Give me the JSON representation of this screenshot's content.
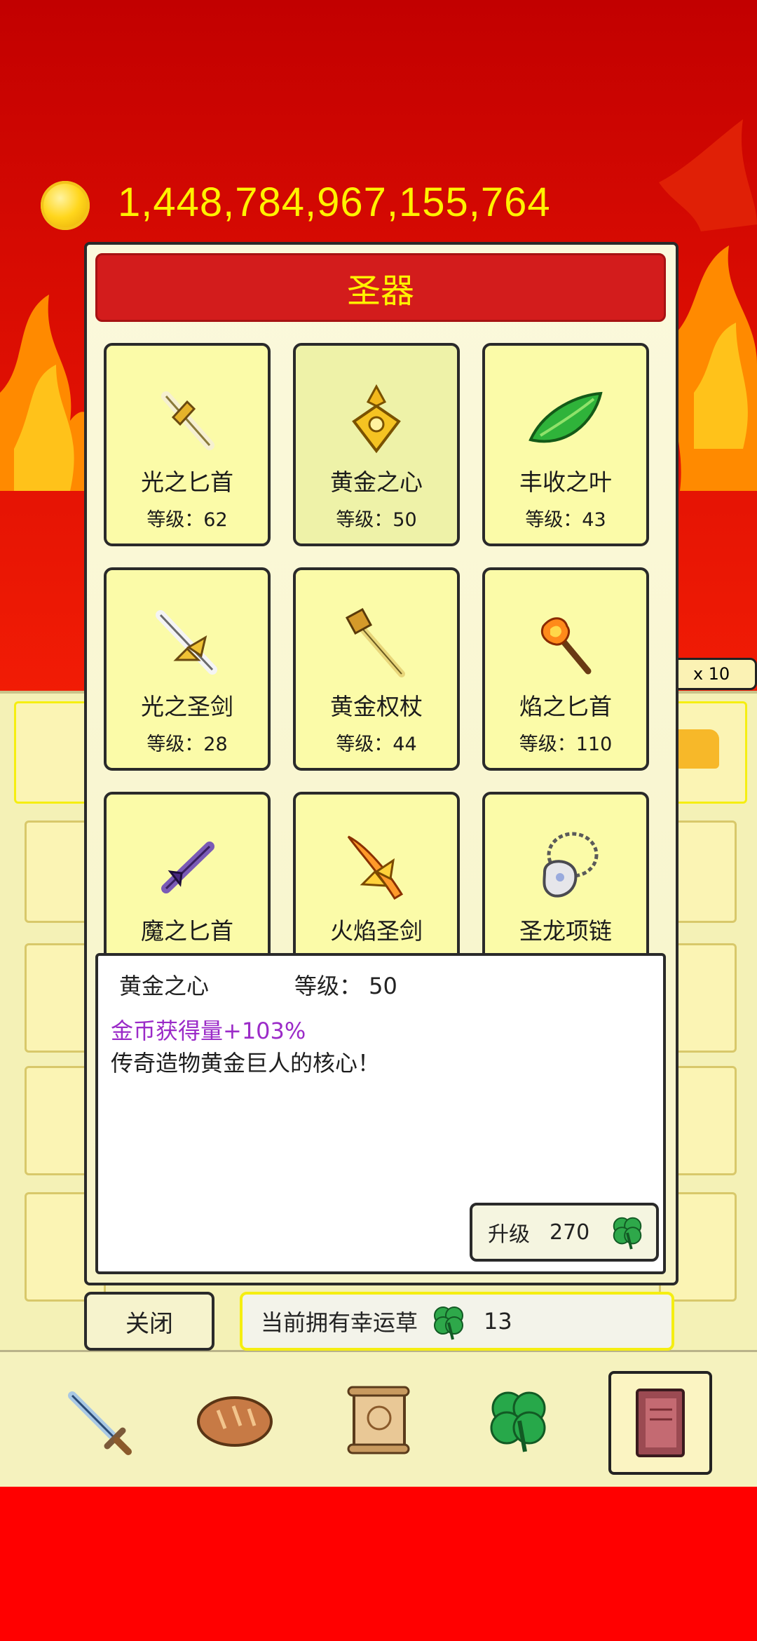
{
  "currency": {
    "amount": "1,448,784,967,155,764",
    "icon": "gold-coin-icon"
  },
  "background": {
    "multiplier_badge": "x 10"
  },
  "dialog": {
    "title": "圣器",
    "artifacts": [
      {
        "name": "光之匕首",
        "level": "等级：62",
        "icon": "light-dagger-icon"
      },
      {
        "name": "黄金之心",
        "level": "等级：50",
        "icon": "golden-heart-icon",
        "selected": true
      },
      {
        "name": "丰收之叶",
        "level": "等级：43",
        "icon": "harvest-leaf-icon"
      },
      {
        "name": "光之圣剑",
        "level": "等级：28",
        "icon": "holy-light-sword-icon"
      },
      {
        "name": "黄金权杖",
        "level": "等级：44",
        "icon": "golden-scepter-icon"
      },
      {
        "name": "焰之匕首",
        "level": "等级：110",
        "icon": "flame-dagger-icon"
      },
      {
        "name": "魔之匕首",
        "level": "",
        "icon": "demon-dagger-icon"
      },
      {
        "name": "火焰圣剑",
        "level": "",
        "icon": "flame-holy-sword-icon"
      },
      {
        "name": "圣龙项链",
        "level": "",
        "icon": "dragon-necklace-icon"
      }
    ],
    "detail": {
      "name": "黄金之心",
      "level_text": "等级：  50",
      "bonus": "金币获得量+103%",
      "description": "传奇造物黄金巨人的核心！",
      "upgrade_label": "升级",
      "upgrade_cost": "270"
    },
    "close_label": "关闭",
    "lucky_clover": {
      "label": "当前拥有幸运草",
      "count": "13"
    }
  },
  "bottom_nav": [
    "sword-icon",
    "bread-icon",
    "scroll-icon",
    "clover-icon",
    "book-icon"
  ],
  "colors": {
    "title_bar": "#d31c1c",
    "title_text": "#fff200",
    "coin_text": "#fff200",
    "bonus_text": "#9b2bc8"
  }
}
